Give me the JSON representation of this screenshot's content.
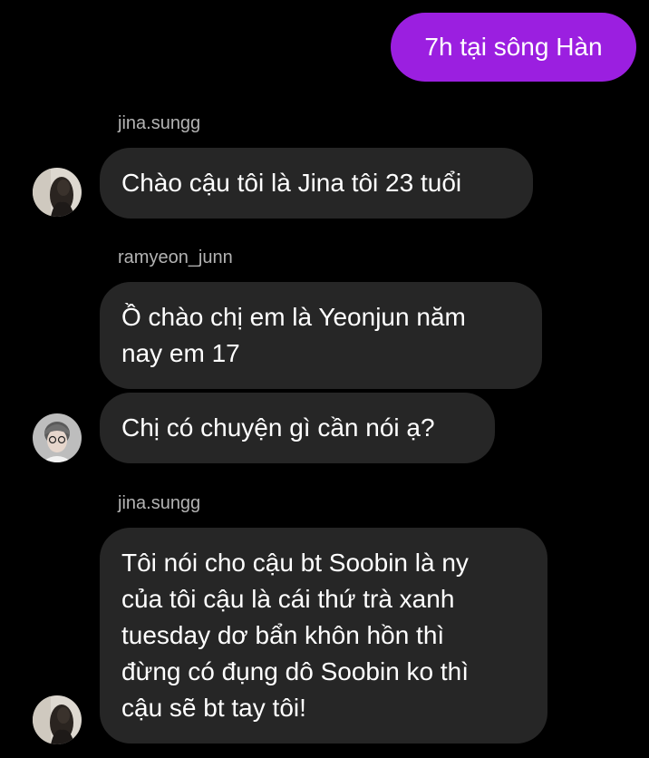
{
  "colors": {
    "background": "#000000",
    "incoming_bubble": "#262626",
    "outgoing_bubble": "#9b1fe0",
    "username_text": "#b3b3b3"
  },
  "outgoing": {
    "text": "7h tại sông Hàn"
  },
  "groups": [
    {
      "username": "jina.sungg",
      "avatar": "jina-avatar",
      "messages": [
        "Chào cậu tôi là Jina tôi 23 tuổi"
      ]
    },
    {
      "username": "ramyeon_junn",
      "avatar": "yeonjun-avatar",
      "messages": [
        "Ồ chào chị em là Yeonjun năm\nnay em 17",
        "Chị có chuyện gì cần nói ạ?"
      ]
    },
    {
      "username": "jina.sungg",
      "avatar": "jina-avatar",
      "messages": [
        "Tôi nói cho cậu bt Soobin là ny\ncủa tôi cậu là cái thứ trà xanh\ntuesday dơ bẩn khôn hồn thì\nđừng có đụng dô Soobin ko thì\ncậu sẽ bt tay tôi!"
      ]
    }
  ]
}
